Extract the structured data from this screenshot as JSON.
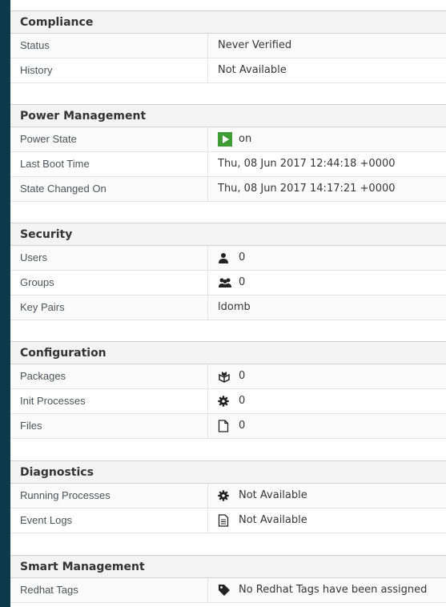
{
  "sections": {
    "compliance": {
      "title": "Compliance",
      "rows": [
        {
          "label": "Status",
          "value": "Never Verified"
        },
        {
          "label": "History",
          "value": "Not Available"
        }
      ]
    },
    "power": {
      "title": "Power Management",
      "rows": [
        {
          "label": "Power State",
          "value": "on",
          "icon": "power-on-icon"
        },
        {
          "label": "Last Boot Time",
          "value": "Thu, 08 Jun 2017 12:44:18 +0000"
        },
        {
          "label": "State Changed On",
          "value": "Thu, 08 Jun 2017 14:17:21 +0000"
        }
      ]
    },
    "security": {
      "title": "Security",
      "rows": [
        {
          "label": "Users",
          "value": "0",
          "icon": "user-icon"
        },
        {
          "label": "Groups",
          "value": "0",
          "icon": "group-icon"
        },
        {
          "label": "Key Pairs",
          "value": "ldomb"
        }
      ]
    },
    "configuration": {
      "title": "Configuration",
      "rows": [
        {
          "label": "Packages",
          "value": "0",
          "icon": "package-icon"
        },
        {
          "label": "Init Processes",
          "value": "0",
          "icon": "gear-icon"
        },
        {
          "label": "Files",
          "value": "0",
          "icon": "file-icon"
        }
      ]
    },
    "diagnostics": {
      "title": "Diagnostics",
      "rows": [
        {
          "label": "Running Processes",
          "value": "Not Available",
          "icon": "gear-icon"
        },
        {
          "label": "Event Logs",
          "value": "Not Available",
          "icon": "document-icon"
        }
      ]
    },
    "smart": {
      "title": "Smart Management",
      "rows": [
        {
          "label": "Redhat Tags",
          "value": "No Redhat Tags have been assigned",
          "icon": "tag-icon"
        }
      ]
    }
  },
  "colors": {
    "background": "#0d3a4a",
    "power_on": "#3f9c35"
  }
}
